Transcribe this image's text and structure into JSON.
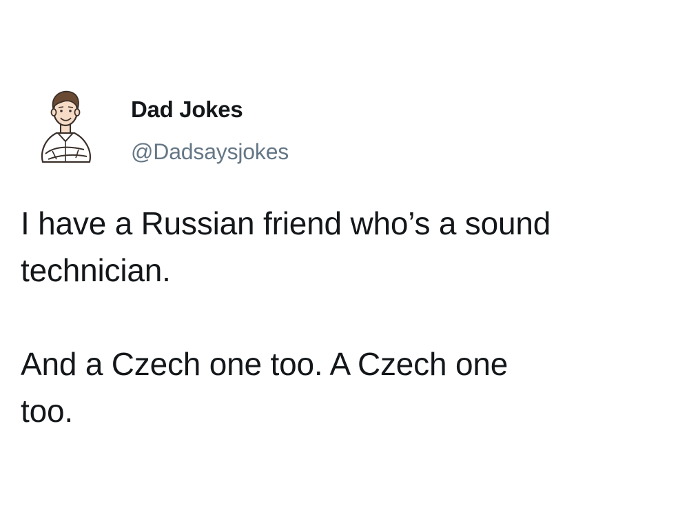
{
  "tweet": {
    "author": {
      "display_name": "Dad Jokes",
      "handle": "@Dadsaysjokes",
      "avatar_icon": "cartoon-dad-avatar-icon"
    },
    "paragraphs": [
      "I have a Russian friend who’s a sound\ntechnician.",
      "And a Czech one too. A Czech one\ntoo."
    ]
  },
  "colors": {
    "background": "#ffffff",
    "text_primary": "#14171a",
    "text_secondary": "#657786"
  }
}
